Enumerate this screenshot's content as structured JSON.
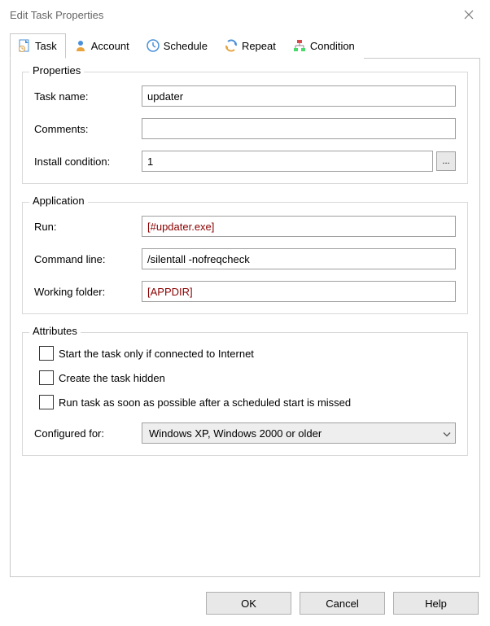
{
  "titlebar": {
    "title": "Edit Task Properties"
  },
  "tabs": {
    "task": "Task",
    "account": "Account",
    "schedule": "Schedule",
    "repeat": "Repeat",
    "condition": "Condition"
  },
  "properties": {
    "legend": "Properties",
    "task_name_label": "Task name:",
    "task_name_value": "updater",
    "comments_label": "Comments:",
    "comments_value": "",
    "install_condition_label": "Install condition:",
    "install_condition_value": "1",
    "browse_label": "..."
  },
  "application": {
    "legend": "Application",
    "run_label": "Run:",
    "run_value": "[#updater.exe]",
    "cmdline_label": "Command line:",
    "cmdline_value": "/silentall -nofreqcheck",
    "working_folder_label": "Working folder:",
    "working_folder_value": "[APPDIR]"
  },
  "attributes": {
    "legend": "Attributes",
    "cb_internet": "Start the task only if connected to Internet",
    "cb_hidden": "Create the task hidden",
    "cb_asap": "Run task as soon as possible after a scheduled start is missed",
    "configured_for_label": "Configured for:",
    "configured_for_value": "Windows XP, Windows 2000 or older"
  },
  "buttons": {
    "ok": "OK",
    "cancel": "Cancel",
    "help": "Help"
  }
}
